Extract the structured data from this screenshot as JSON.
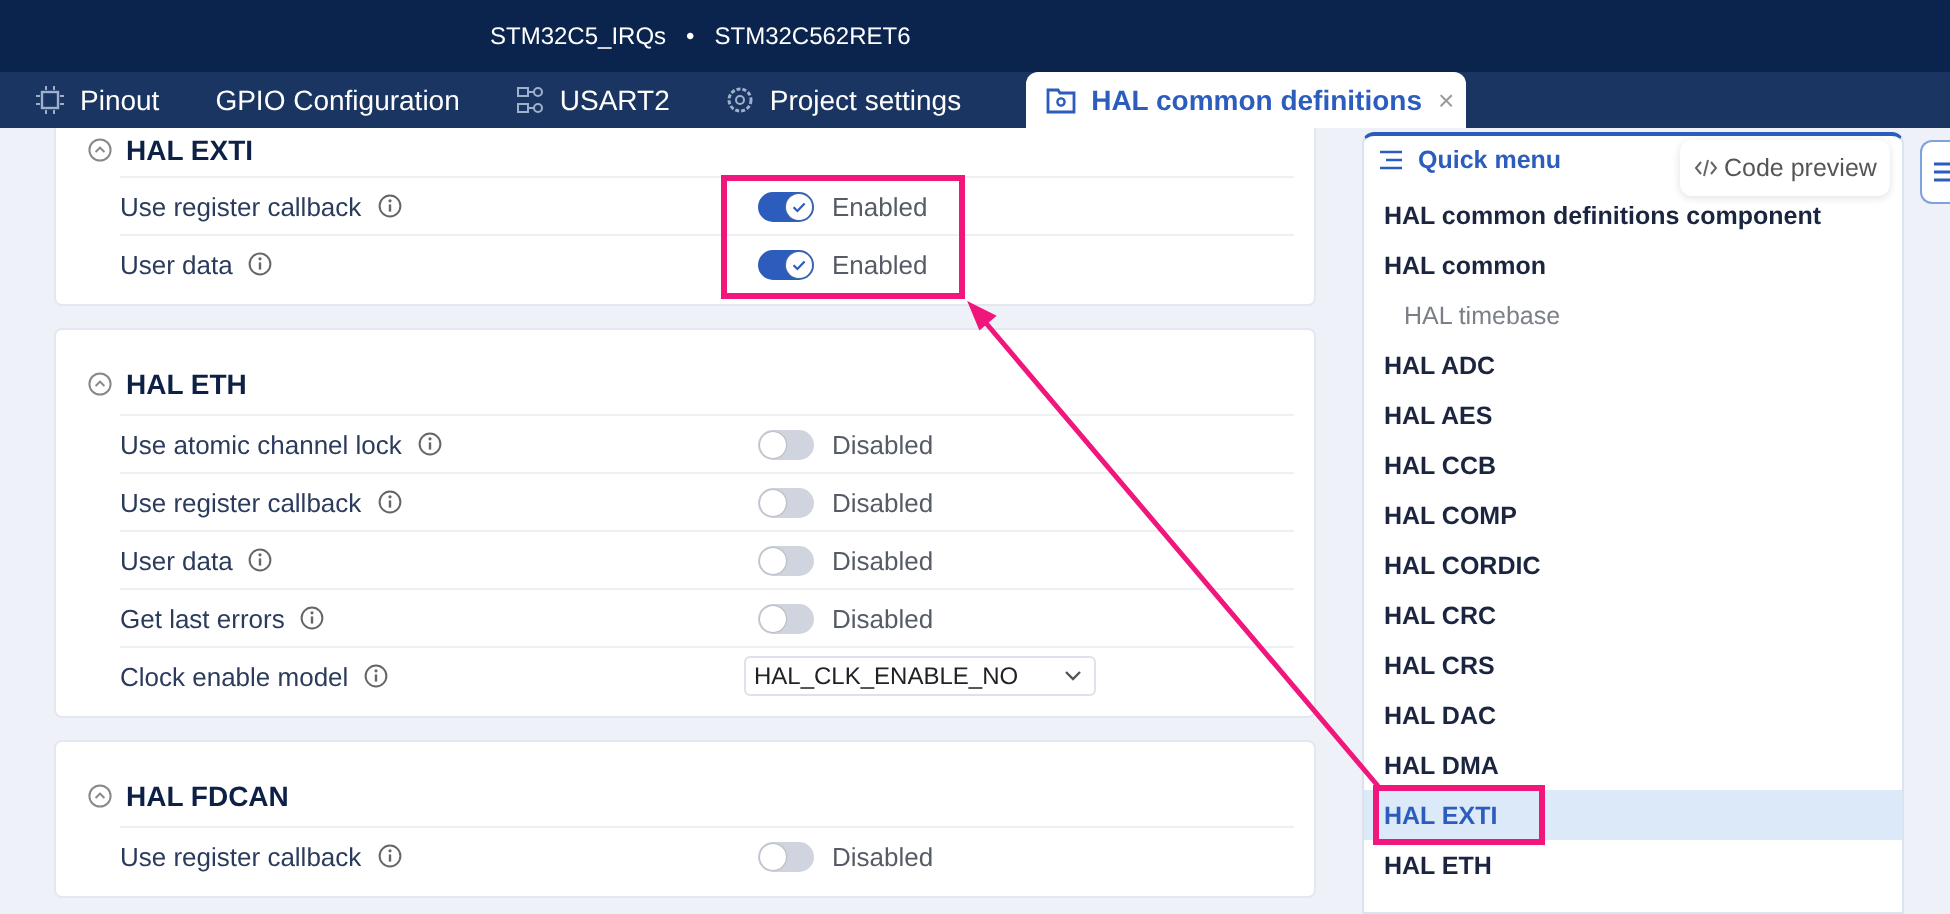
{
  "window": {
    "title": "STM32C5_IRQs",
    "separator": "•",
    "device": "STM32C562RET6"
  },
  "tabs": [
    {
      "label": "Pinout",
      "selected": false
    },
    {
      "label": "GPIO Configuration",
      "selected": false
    },
    {
      "label": "USART2",
      "selected": false
    },
    {
      "label": "Project settings",
      "selected": false
    },
    {
      "label": "HAL common definitions",
      "selected": true,
      "close": "×"
    }
  ],
  "sections": [
    {
      "title": "HAL EXTI",
      "expanded": true,
      "rows": [
        {
          "kind": "toggle",
          "label": "Use register callback",
          "on": true,
          "state": "Enabled"
        },
        {
          "kind": "toggle",
          "label": "User data",
          "on": true,
          "state": "Enabled"
        }
      ]
    },
    {
      "title": "HAL ETH",
      "expanded": true,
      "rows": [
        {
          "kind": "toggle",
          "label": "Use atomic channel lock",
          "on": false,
          "state": "Disabled"
        },
        {
          "kind": "toggle",
          "label": "Use register callback",
          "on": false,
          "state": "Disabled"
        },
        {
          "kind": "toggle",
          "label": "User data",
          "on": false,
          "state": "Disabled"
        },
        {
          "kind": "toggle",
          "label": "Get last errors",
          "on": false,
          "state": "Disabled"
        },
        {
          "kind": "select",
          "label": "Clock enable model",
          "value": "HAL_CLK_ENABLE_NO"
        }
      ]
    },
    {
      "title": "HAL FDCAN",
      "expanded": true,
      "rows": [
        {
          "kind": "toggle",
          "label": "Use register callback",
          "on": false,
          "state": "Disabled"
        }
      ]
    }
  ],
  "quick_menu": {
    "title": "Quick menu",
    "code_preview": "Code preview",
    "items": [
      {
        "label": "HAL common definitions component",
        "selected": false
      },
      {
        "label": "HAL common",
        "selected": false,
        "children": [
          {
            "label": "HAL timebase",
            "selected": false
          }
        ]
      },
      {
        "label": "HAL ADC",
        "selected": false
      },
      {
        "label": "HAL AES",
        "selected": false
      },
      {
        "label": "HAL CCB",
        "selected": false
      },
      {
        "label": "HAL COMP",
        "selected": false
      },
      {
        "label": "HAL CORDIC",
        "selected": false
      },
      {
        "label": "HAL CRC",
        "selected": false
      },
      {
        "label": "HAL CRS",
        "selected": false
      },
      {
        "label": "HAL DAC",
        "selected": false
      },
      {
        "label": "HAL DMA",
        "selected": false
      },
      {
        "label": "HAL EXTI",
        "selected": true
      },
      {
        "label": "HAL ETH",
        "selected": false
      }
    ]
  }
}
